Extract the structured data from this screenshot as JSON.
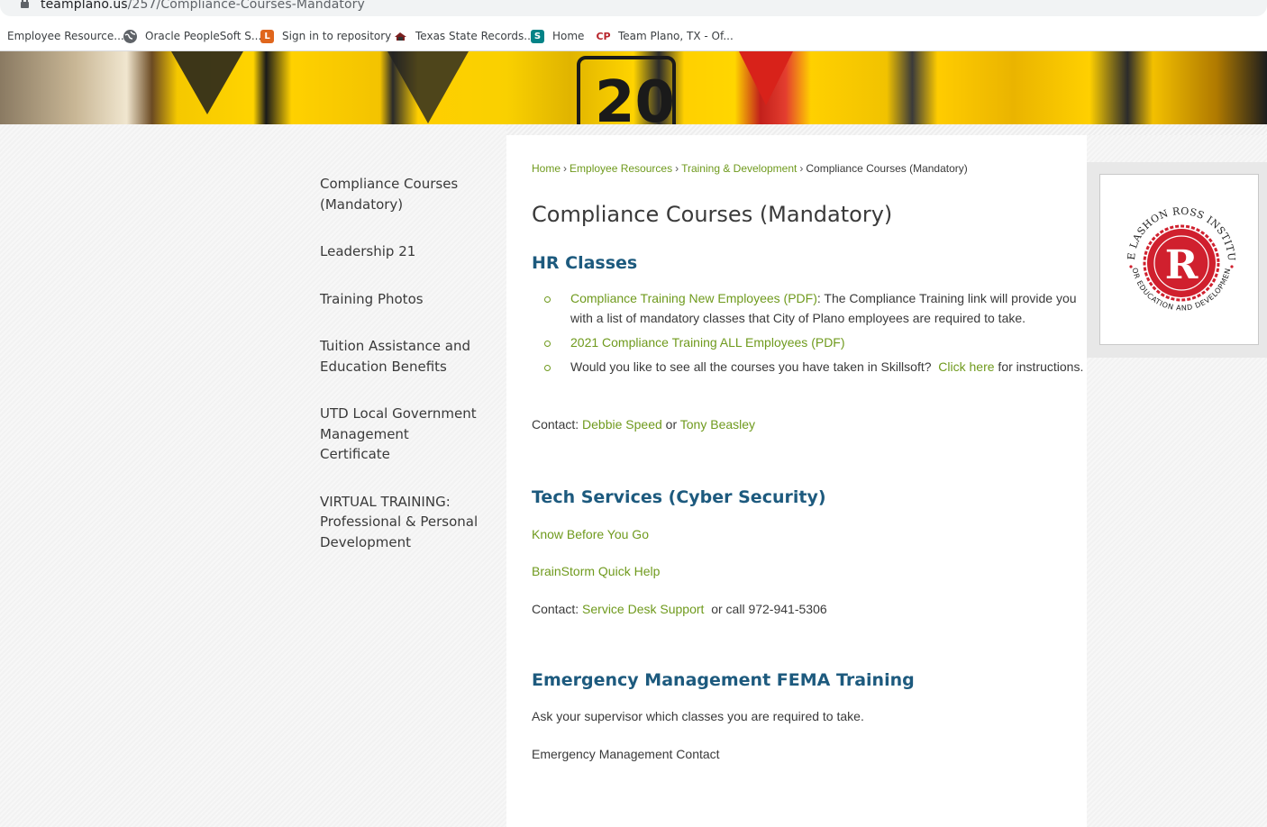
{
  "browser": {
    "url_host": "teamplano.us",
    "url_path": "/257/Compliance-Courses-Mandatory"
  },
  "bookmarks": [
    {
      "label": "Employee Resource...",
      "icon": "none"
    },
    {
      "label": "Oracle PeopleSoft S...",
      "icon": "globe-icon"
    },
    {
      "label": "Sign in to repository",
      "icon": "l-logo-icon"
    },
    {
      "label": "Texas State Records...",
      "icon": "texas-records-icon"
    },
    {
      "label": "Home",
      "icon": "sharepoint-icon"
    },
    {
      "label": "Team Plano, TX - Of...",
      "icon": "cp-logo-icon"
    }
  ],
  "sidebar": {
    "items": [
      {
        "label": "Compliance Courses (Mandatory)"
      },
      {
        "label": "Leadership 21"
      },
      {
        "label": "Training Photos"
      },
      {
        "label": "Tuition Assistance and Education Benefits"
      },
      {
        "label": "UTD Local Government Management Certificate"
      },
      {
        "label": "VIRTUAL TRAINING: Professional & Personal Development"
      }
    ]
  },
  "breadcrumb": {
    "home": "Home",
    "employee_resources": "Employee Resources",
    "training": "Training & Development",
    "current": "Compliance Courses (Mandatory)",
    "sep": "›"
  },
  "main": {
    "title": "Compliance Courses (Mandatory)",
    "hr": {
      "heading": "HR Classes",
      "item1_link": "Compliance Training New Employees (PDF)",
      "item1_text": ": The Compliance Training link will provide you with a list of mandatory classes that City of Plano employees are required to take.",
      "item2_link": "2021 Compliance Training ALL Employees (PDF)",
      "item3_text_a": "Would you like to see all the courses you have taken in Skillsoft?  ",
      "item3_link": "Click here",
      "item3_text_b": " for instructions.",
      "contact_label": "Contact: ",
      "contact_1": "Debbie Speed",
      "contact_or": " or ",
      "contact_2": "Tony Beasley"
    },
    "tech": {
      "heading": "Tech Services (Cyber Security)",
      "link1": "Know Before You Go",
      "link2": "BrainStorm Quick Help",
      "contact_label": "Contact: ",
      "contact_link": "Service Desk Support",
      "contact_tail": "  or call 972-941-5306"
    },
    "fema": {
      "heading": "Emergency Management FEMA Training",
      "text": "Ask your supervisor which classes you are required to take.",
      "contact": "Emergency Management Contact"
    }
  },
  "logo": {
    "ring_text": "THE LASHON ROSS INSTITUTE",
    "bottom_text": "FOR EDUCATION AND DEVELOPMENT",
    "letter": "R"
  },
  "banner": {
    "speed": "20"
  },
  "colors": {
    "link": "#6f9a1d",
    "heading": "#1d5a7e",
    "seal_red": "#d0202e"
  }
}
